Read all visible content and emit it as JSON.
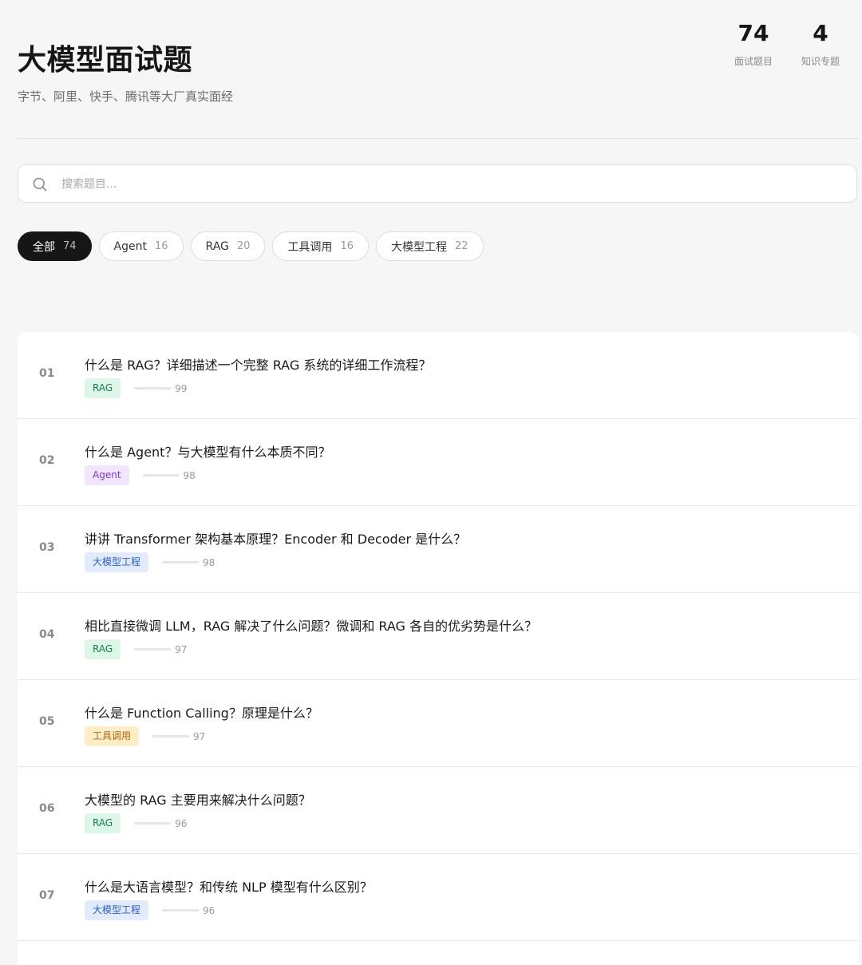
{
  "header": {
    "title": "大模型面试题",
    "subtitle": "字节、阿里、快手、腾讯等大厂真实面经"
  },
  "stats": [
    {
      "value": "74",
      "label": "面试题目"
    },
    {
      "value": "4",
      "label": "知识专题"
    }
  ],
  "search": {
    "placeholder": "搜索题目..."
  },
  "filters": [
    {
      "label": "全部",
      "count": "74",
      "active": true
    },
    {
      "label": "Agent",
      "count": "16",
      "active": false
    },
    {
      "label": "RAG",
      "count": "20",
      "active": false
    },
    {
      "label": "工具调用",
      "count": "16",
      "active": false
    },
    {
      "label": "大模型工程",
      "count": "22",
      "active": false
    }
  ],
  "tag_colors": {
    "RAG": {
      "bg": "#dcf6e8",
      "fg": "#17804b"
    },
    "Agent": {
      "bg": "#f1e6fd",
      "fg": "#7c3ad6"
    },
    "大模型工程": {
      "bg": "#e1ebfc",
      "fg": "#2d5fc6"
    },
    "工具调用": {
      "bg": "#fdeec8",
      "fg": "#b3660f"
    }
  },
  "questions": [
    {
      "num": "01",
      "title": "什么是 RAG？详细描述一个完整 RAG 系统的详细工作流程？",
      "tag": "RAG",
      "score": "99"
    },
    {
      "num": "02",
      "title": "什么是 Agent？与大模型有什么本质不同？",
      "tag": "Agent",
      "score": "98"
    },
    {
      "num": "03",
      "title": "讲讲 Transformer 架构基本原理？Encoder 和 Decoder 是什么？",
      "tag": "大模型工程",
      "score": "98"
    },
    {
      "num": "04",
      "title": "相比直接微调 LLM，RAG 解决了什么问题？微调和 RAG 各自的优劣势是什么？",
      "tag": "RAG",
      "score": "97"
    },
    {
      "num": "05",
      "title": "什么是 Function Calling？原理是什么？",
      "tag": "工具调用",
      "score": "97"
    },
    {
      "num": "06",
      "title": "大模型的 RAG 主要用来解决什么问题？",
      "tag": "RAG",
      "score": "96"
    },
    {
      "num": "07",
      "title": "什么是大语言模型？和传统 NLP 模型有什么区别？",
      "tag": "大模型工程",
      "score": "96"
    }
  ]
}
